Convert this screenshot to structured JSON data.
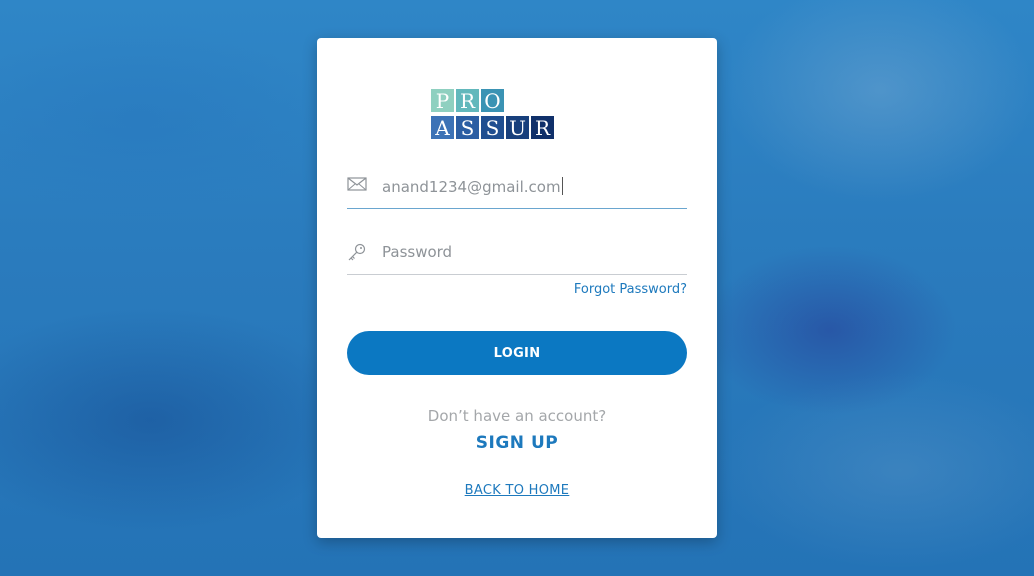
{
  "logo": {
    "top_letters": [
      "P",
      "R",
      "O"
    ],
    "bottom_letters": [
      "A",
      "S",
      "S",
      "U",
      "R"
    ],
    "top_colors": [
      "#7cc8b5",
      "#5bb3b8",
      "#2f8fb0"
    ],
    "bottom_colors": [
      "#3a6fb3",
      "#2a5a9f",
      "#1c4a8a",
      "#153b78",
      "#0f2f66"
    ]
  },
  "form": {
    "email": {
      "icon": "envelope-icon",
      "value": "anand1234@gmail.com"
    },
    "password": {
      "icon": "key-icon",
      "placeholder": "Password"
    },
    "forgot_label": "Forgot Password?",
    "login_label": "LOGIN"
  },
  "footer": {
    "no_account_text": "Don’t have an account?",
    "signup_label": "SIGN UP",
    "back_home_label": "BACK TO HOME"
  },
  "colors": {
    "accent": "#0b78c2",
    "link": "#1d79bd",
    "background": "#2a7bbd"
  }
}
